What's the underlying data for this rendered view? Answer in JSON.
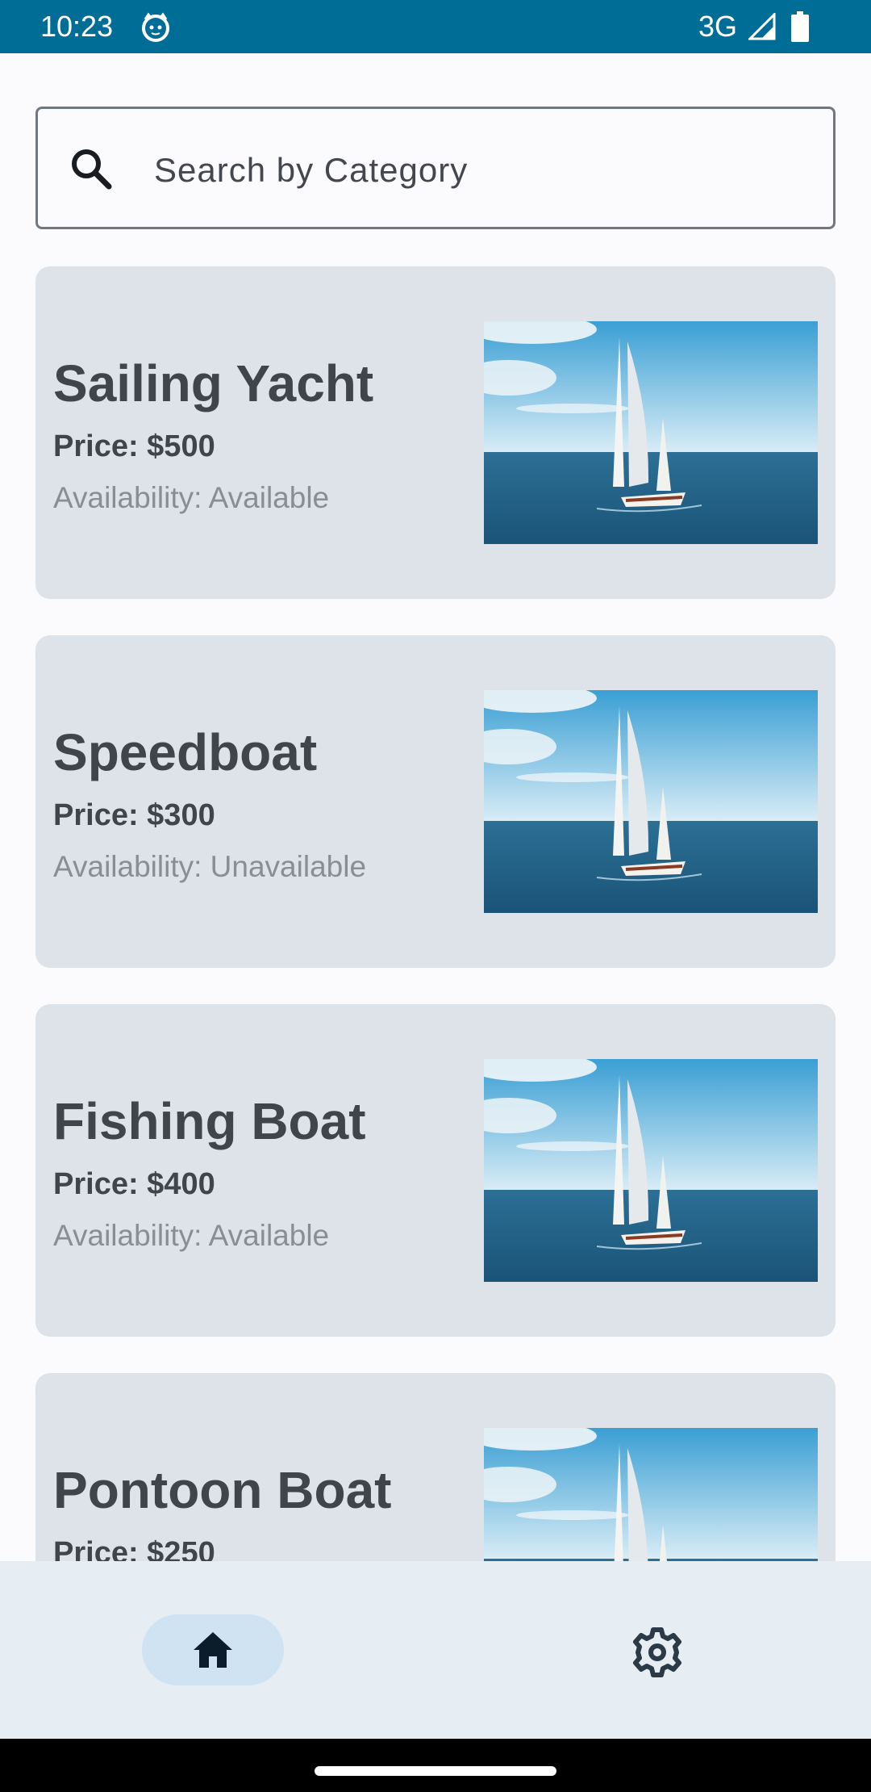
{
  "status_bar": {
    "time": "10:23",
    "network": "3G",
    "icons": [
      "cat-face-icon",
      "signal-icon",
      "battery-icon"
    ]
  },
  "search": {
    "placeholder": "Search by Category",
    "value": "",
    "icon": "search-icon"
  },
  "listings": [
    {
      "title": "Sailing Yacht",
      "price": "Price: $500",
      "availability": "Availability: Available"
    },
    {
      "title": "Speedboat",
      "price": "Price: $300",
      "availability": "Availability: Unavailable"
    },
    {
      "title": "Fishing Boat",
      "price": "Price: $400",
      "availability": "Availability: Available"
    },
    {
      "title": "Pontoon Boat",
      "price": "Price: $250",
      "availability": ""
    }
  ],
  "bottom_nav": {
    "items": [
      {
        "name": "home",
        "icon": "home-icon",
        "selected": true
      },
      {
        "name": "settings",
        "icon": "gear-icon",
        "selected": false
      }
    ]
  },
  "colors": {
    "status_bar": "#006d96",
    "card_background": "#dde3e9",
    "nav_background": "#e6eef4",
    "nav_selected": "#cfe3f3",
    "title_text": "#40454c",
    "secondary_text": "#8a8e94"
  }
}
